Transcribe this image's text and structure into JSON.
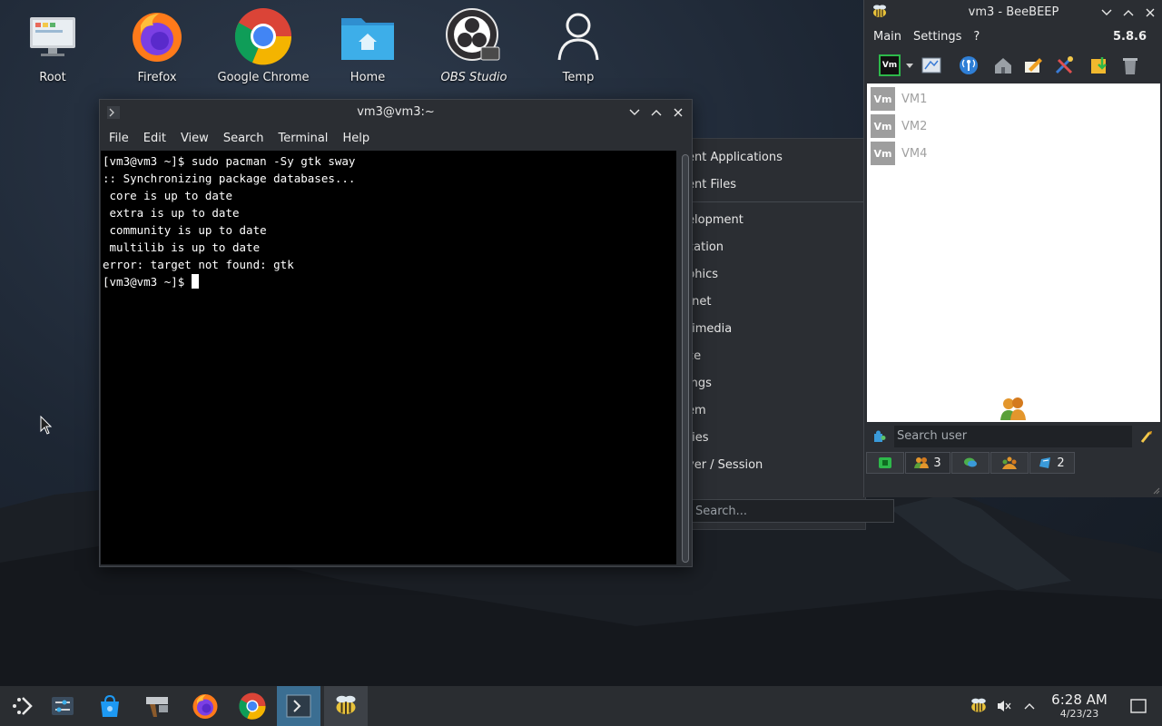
{
  "desktop": {
    "icons": [
      {
        "label": "Root",
        "icon": "monitor-icon"
      },
      {
        "label": "Firefox",
        "icon": "firefox-icon"
      },
      {
        "label": "Google Chrome",
        "icon": "chrome-icon"
      },
      {
        "label": "Home",
        "icon": "home-folder-icon"
      },
      {
        "label": "OBS Studio",
        "icon": "obs-icon"
      },
      {
        "label": "Temp",
        "icon": "user-icon"
      }
    ]
  },
  "launcher": {
    "items": [
      "ent Applications",
      "ent Files",
      "elopment",
      "cation",
      "phics",
      "rnet",
      "timedia",
      "ce",
      "ings",
      "em",
      "ties",
      "ver / Session"
    ],
    "search_placeholder": "Search..."
  },
  "terminal": {
    "title": "vm3@vm3:~",
    "menu": [
      "File",
      "Edit",
      "View",
      "Search",
      "Terminal",
      "Help"
    ],
    "lines": [
      "[vm3@vm3 ~]$ sudo pacman -Sy gtk sway",
      ":: Synchronizing package databases...",
      " core is up to date",
      " extra is up to date",
      " community is up to date",
      " multilib is up to date",
      "error: target not found: gtk"
    ],
    "prompt": "[vm3@vm3 ~]$ "
  },
  "beebeep": {
    "title": "vm3 - BeeBEEP",
    "menu": [
      "Main",
      "Settings",
      "?"
    ],
    "version": "5.8.6",
    "users": [
      {
        "avatar": "Vm",
        "name": "VM1"
      },
      {
        "avatar": "Vm",
        "name": "VM2"
      },
      {
        "avatar": "Vm",
        "name": "VM4"
      }
    ],
    "my_avatar": "Vm",
    "search_placeholder": "Search user",
    "tabs": [
      {
        "icon": "status-icon",
        "count": ""
      },
      {
        "icon": "users-icon",
        "count": "3"
      },
      {
        "icon": "chat-icon",
        "count": ""
      },
      {
        "icon": "groups-icon",
        "count": ""
      },
      {
        "icon": "files-icon",
        "count": "2"
      }
    ]
  },
  "taskbar": {
    "time": "6:28 AM",
    "date": "4/23/23"
  },
  "colors": {
    "terminal_bg": "#000000",
    "window_bg": "#2b2e33",
    "taskbar_bg": "#2a2d31",
    "active_task": "#3b6e92"
  }
}
